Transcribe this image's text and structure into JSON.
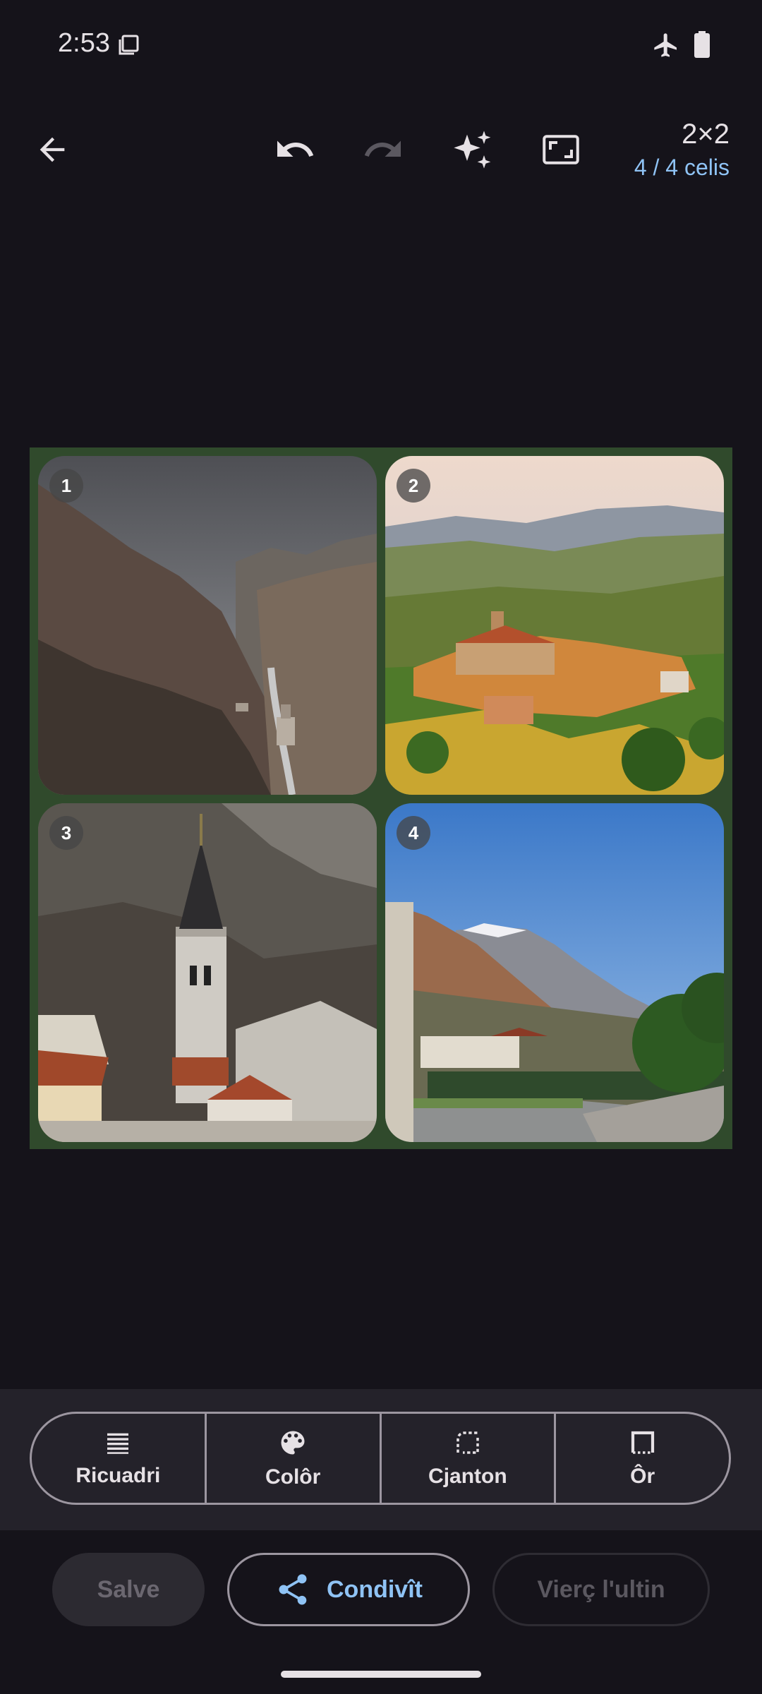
{
  "status_bar": {
    "time": "2:53"
  },
  "toolbar": {
    "back": "back-arrow-icon",
    "undo": "undo-icon",
    "redo": "redo-icon",
    "magic": "sparkle-icon",
    "aspect": "aspect-ratio-icon",
    "grid_size": "2×2",
    "cells_count": "4 / 4 celis"
  },
  "collage": {
    "border_color": "#304a2c",
    "cells": [
      {
        "number": "1",
        "image": "mountain valley with river"
      },
      {
        "number": "2",
        "image": "hilltop village among vineyards"
      },
      {
        "number": "3",
        "image": "church bell tower before mountains"
      },
      {
        "number": "4",
        "image": "snowy peaks above town and stone wall"
      }
    ]
  },
  "tools": [
    {
      "label": "Ricuadri",
      "icon": "lines-icon"
    },
    {
      "label": "Colôr",
      "icon": "palette-icon"
    },
    {
      "label": "Cjanton",
      "icon": "corner-icon"
    },
    {
      "label": "Ôr",
      "icon": "border-icon"
    }
  ],
  "actions": {
    "save": "Salve",
    "share": "Condivît",
    "open": "Vierç l'ultin"
  },
  "colors": {
    "accent": "#8fc3f5",
    "background": "#15131a"
  }
}
